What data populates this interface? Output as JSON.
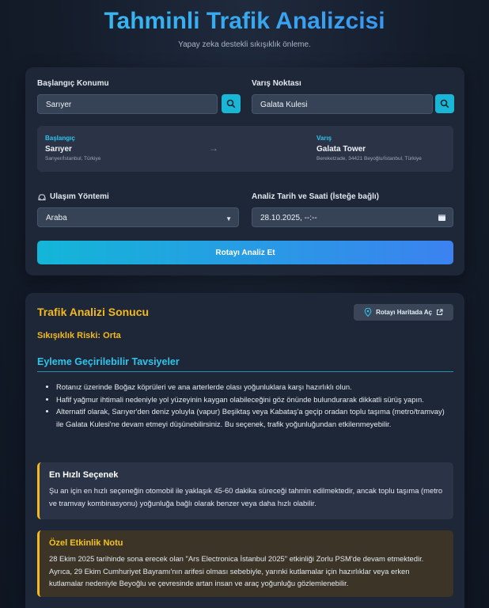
{
  "header": {
    "title": "Tahminli Trafik Analizcisi",
    "subtitle": "Yapay zeka destekli sıkışıklık önleme."
  },
  "form": {
    "start_label": "Başlangıç Konumu",
    "start_value": "Sarıyer",
    "end_label": "Varış Noktası",
    "end_value": "Galata Kulesi",
    "summary": {
      "start_head": "Başlangıç",
      "start_name": "Sarıyer",
      "start_addr": "Sarıyer/İstanbul, Türkiye",
      "end_head": "Varış",
      "end_name": "Galata Tower",
      "end_addr": "Bereketzade, 34421 Beyoğlu/İstanbul, Türkiye"
    },
    "mode_label": "Ulaşım Yöntemi",
    "mode_value": "Araba",
    "datetime_label": "Analiz Tarih ve Saati (İsteğe bağlı)",
    "datetime_value": "28.10.2025, --:--",
    "analyze_button": "Rotayı Analiz Et"
  },
  "result": {
    "title": "Trafik Analizi Sonucu",
    "map_button": "Rotayı Haritada Aç",
    "risk": "Sıkışıklık Riski: Orta",
    "recommendations_title": "Eyleme Geçirilebilir Tavsiyeler",
    "recommendations": [
      "Rotanız üzerinde Boğaz köprüleri ve ana arterlerde olası yoğunluklara karşı hazırlıklı olun.",
      "Hafif yağmur ihtimali nedeniyle yol yüzeyinin kaygan olabileceğini göz önünde bulundurarak dikkatli sürüş yapın.",
      "Alternatif olarak, Sarıyer'den deniz yoluyla (vapur) Beşiktaş veya Kabataş'a geçip oradan toplu taşıma (metro/tramvay) ile Galata Kulesi'ne devam etmeyi düşünebilirsiniz. Bu seçenek, trafik yoğunluğundan etkilenmeyebilir."
    ],
    "fastest_title": "En Hızlı Seçenek",
    "fastest_body": "Şu an için en hızlı seçeneğin otomobil ile yaklaşık 45-60 dakika süreceği tahmin edilmektedir, ancak toplu taşıma (metro ve tramvay kombinasyonu) yoğunluğa bağlı olarak benzer veya daha hızlı olabilir.",
    "event_title": "Özel Etkinlik Notu",
    "event_body": "28 Ekim 2025 tarihinde sona erecek olan \"Ars Electronica İstanbul 2025\" etkinliği Zorlu PSM'de devam etmektedir. Ayrıca, 29 Ekim Cumhuriyet Bayramı'nın arifesi olması sebebiyle, yarınki kutlamalar için hazırlıklar veya erken kutlamalar nedeniyle Beyoğlu ve çevresinde artan insan ve araç yoğunluğu gözlemlenebilir."
  },
  "colors": {
    "accent_cyan": "#2ec4ec",
    "accent_yellow": "#f5b91c",
    "card_bg": "#1e2737"
  }
}
